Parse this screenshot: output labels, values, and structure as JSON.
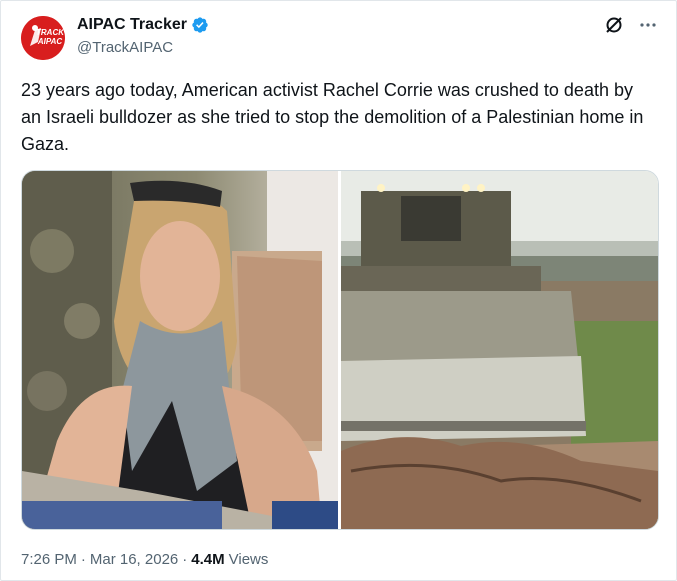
{
  "account": {
    "display_name": "AIPAC Tracker",
    "handle": "@TrackAIPAC",
    "avatar_text_line1": "TRACK",
    "avatar_text_line2": "AIPAC",
    "verified": true
  },
  "icons": {
    "grok": "grok-slash-circle-icon",
    "more": "more-horizontal-icon",
    "verified": "verified-badge-icon"
  },
  "tweet": {
    "text": "23 years ago today, American activist Rachel Corrie was crushed to death by an Israeli bulldozer as she tried to stop the demolition of a Palestinian home in Gaza.",
    "time": "7:26 PM",
    "date": "Mar 16, 2026",
    "views_count": "4.4M",
    "views_label": "Views",
    "separator": "·"
  },
  "colors": {
    "text": "#0f1419",
    "secondary": "#536471",
    "verified_blue": "#1d9bf0",
    "avatar_red": "#d81e1e",
    "border": "#cfd9de"
  }
}
